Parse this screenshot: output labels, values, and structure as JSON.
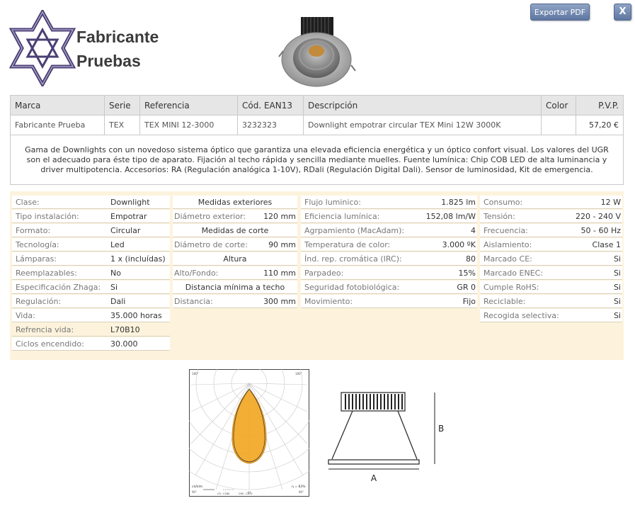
{
  "header": {
    "brand_line1": "Fabricante",
    "brand_line2": "Pruebas",
    "export_pdf_label": "Exportar PDF",
    "close_label": "X"
  },
  "product_table": {
    "headers": [
      "Marca",
      "Serie",
      "Referencia",
      "Cód. EAN13",
      "Descripción",
      "Color",
      "P.V.P."
    ],
    "row": [
      "Fabricante Prueba",
      "TEX",
      "TEX MINI 12-3000",
      "3232323",
      "Downlight empotrar circular TEX Mini 12W 3000K",
      "",
      "57,20 €"
    ]
  },
  "description": "Gama de Downlights con un novedoso sistema óptico que garantiza una elevada eficiencia energética y un óptico confort visual. Los valores del UGR son el adecuado para éste tipo de aparato. Fijación al techo rápida y sencilla mediante muelles. Fuente lumínica: Chip COB LED de alta luminancia y driver multipotencia. Accesorios: RA (Regulación analógica 1-10V), RDali (Regulación Digital Dali). Sensor de luminosidad, Kit de emergencia.",
  "specs": {
    "col1": [
      {
        "label": "Clase:",
        "value": "Downlight"
      },
      {
        "label": "Tipo instalación:",
        "value": "Empotrar"
      },
      {
        "label": "Formato:",
        "value": "Circular"
      },
      {
        "label": "Tecnología:",
        "value": "Led"
      },
      {
        "label": "Lámparas:",
        "value": "1 x (incluídas)"
      },
      {
        "label": "Reemplazables:",
        "value": "No"
      },
      {
        "label": "Especificación Zhaga:",
        "value": "Si"
      },
      {
        "label": "Regulación:",
        "value": "Dali"
      },
      {
        "label": "Vida:",
        "value": "35.000 horas"
      },
      {
        "label": "Refrencia vida:",
        "value": "L70B10"
      },
      {
        "label": "Ciclos encendido:",
        "value": "30.000"
      }
    ],
    "col2": {
      "ext_title": "Medidas exteriores",
      "ext_label": "Diámetro exterior:",
      "ext_value": "120 mm",
      "cut_title": "Medidas de corte",
      "cut_label": "Diámetro de corte:",
      "cut_value": "90 mm",
      "height_title": "Altura",
      "height_label": "Alto/Fondo:",
      "height_value": "110 mm",
      "dist_title": "Distancia mínima a techo",
      "dist_label": "Distancia:",
      "dist_value": "300 mm"
    },
    "col3": [
      {
        "label": "Flujo luminico:",
        "value": "1.825 lm"
      },
      {
        "label": "Eficiencia lumínica:",
        "value": "152,08 lm/W"
      },
      {
        "label": "Agrpamiento (MacAdam):",
        "value": "4"
      },
      {
        "label": "Temperatura de color:",
        "value": "3.000 ºK"
      },
      {
        "label": "Índ. rep. cromática (IRC):",
        "value": "80"
      },
      {
        "label": "Parpadeo:",
        "value": "15%"
      },
      {
        "label": "Seguridad fotobiológica:",
        "value": "GR 0"
      },
      {
        "label": "Movimiento:",
        "value": "Fijo"
      }
    ],
    "col4": [
      {
        "label": "Consumo:",
        "value": "12 W"
      },
      {
        "label": "Tensión:",
        "value": "220 - 240 V"
      },
      {
        "label": "Frecuencia:",
        "value": "50 - 60 Hz"
      },
      {
        "label": "Aislamiento:",
        "value": "Clase 1"
      },
      {
        "label": "Marcado CE:",
        "value": "Si"
      },
      {
        "label": "Marcado ENEC:",
        "value": "Si"
      },
      {
        "label": "Cumple RoHS:",
        "value": "Si"
      },
      {
        "label": "Reciclable:",
        "value": "Si"
      },
      {
        "label": "Recogida selectiva:",
        "value": "Si"
      }
    ]
  },
  "polar_diagram": {
    "unit_label": "cd/klm",
    "efficiency_label": "η = 83%",
    "legend": [
      "C0 - C180",
      "C90 - C270"
    ]
  },
  "dimension_diagram": {
    "label_a": "A",
    "label_b": "B"
  },
  "colors": {
    "button": "#6c82ab",
    "specs_bg": "#fdf3dd",
    "header_bg": "#e6e6e6",
    "star": "#4b3f74"
  }
}
